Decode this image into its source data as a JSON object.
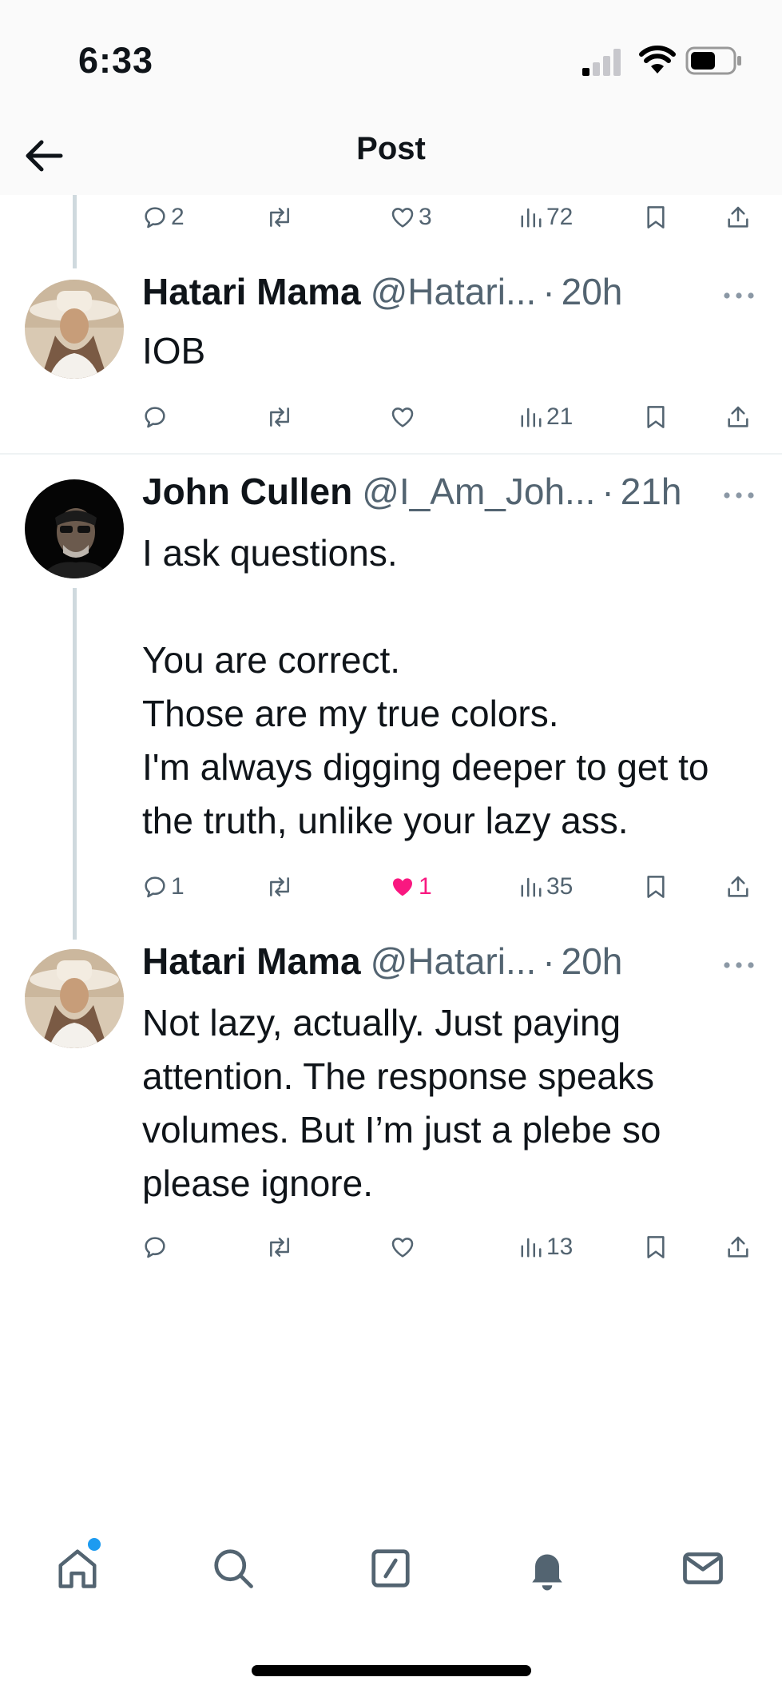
{
  "status_bar": {
    "time": "6:33"
  },
  "header": {
    "title": "Post"
  },
  "top_actions": {
    "replies": "2",
    "likes": "3",
    "views": "72"
  },
  "posts": [
    {
      "display_name": "Hatari Mama",
      "handle": "@Hatari...",
      "time": "20h",
      "text": "IOB",
      "views": "21"
    },
    {
      "display_name": "John Cullen",
      "handle": "@I_Am_Joh...",
      "time": "21h",
      "text": "I ask questions.\n\nYou are correct.\nThose are my true colors.\nI'm always digging deeper to get to the truth, unlike your lazy ass.",
      "replies": "1",
      "likes": "1",
      "views": "35"
    },
    {
      "display_name": "Hatari Mama",
      "handle": "@Hatari...",
      "time": "20h",
      "text": "Not lazy, actually. Just paying attention. The response speaks volumes. But I’m just a plebe so please ignore.",
      "views": "13"
    }
  ],
  "separator": "·",
  "icons": [
    "back-arrow-icon",
    "reply-icon",
    "retweet-icon",
    "heart-icon",
    "views-icon",
    "bookmark-icon",
    "share-icon",
    "more-icon",
    "home-icon",
    "search-icon",
    "compose-icon",
    "bell-icon",
    "mail-icon"
  ],
  "colors": {
    "like_active": "#f91880",
    "muted": "#536471",
    "notification_dot": "#1d9bf0"
  }
}
